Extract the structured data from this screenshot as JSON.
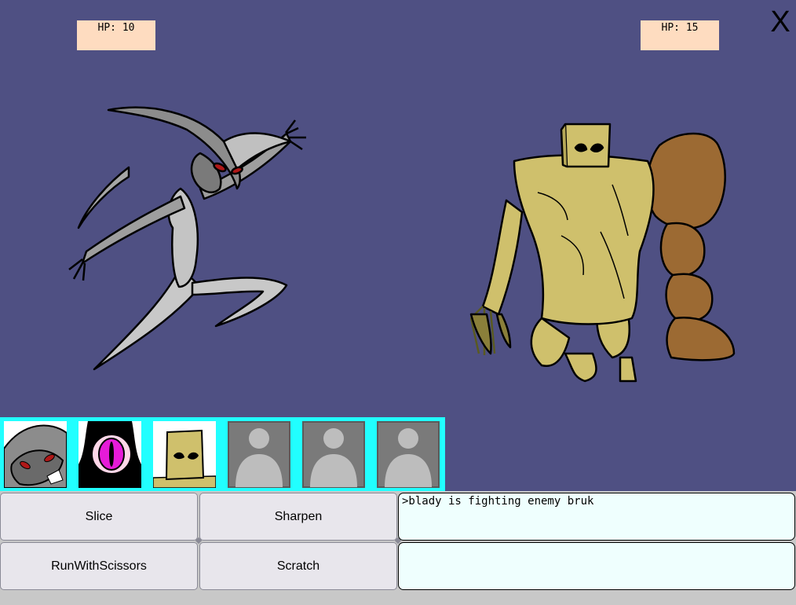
{
  "player": {
    "hp_text": "HP: 10",
    "hp": 10
  },
  "enemy": {
    "hp_text": "HP: 15",
    "hp": 15
  },
  "close": {
    "label": "X"
  },
  "moves": [
    {
      "label": "Slice"
    },
    {
      "label": "Sharpen"
    },
    {
      "label": "RunWithScissors"
    },
    {
      "label": "Scratch"
    }
  ],
  "log": {
    "lines": [
      ">blady is fighting enemy bruk",
      ""
    ]
  },
  "colors": {
    "background": "#4f5083",
    "hp_box": "#fedcc0",
    "party_bar": "#21ffff",
    "log_bg": "#effffe",
    "button_bg": "#e8e6ec"
  }
}
